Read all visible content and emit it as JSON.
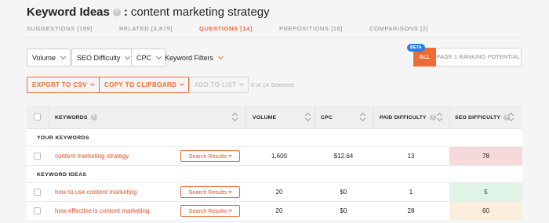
{
  "title": {
    "prefix": "Keyword Ideas",
    "separator": ":",
    "query": "content marketing strategy"
  },
  "tabs": [
    {
      "label": "SUGGESTIONS [199]",
      "active": false
    },
    {
      "label": "RELATED [3,879]",
      "active": false
    },
    {
      "label": "QUESTIONS [14]",
      "active": true
    },
    {
      "label": "PREPOSITIONS [16]",
      "active": false
    },
    {
      "label": "COMPARISONS [2]",
      "active": false
    }
  ],
  "filters": {
    "volume": "Volume",
    "seo_difficulty": "SEO Difficulty",
    "cpc": "CPC",
    "keyword_filters": "Keyword Filters"
  },
  "toggle": {
    "badge": "BETA",
    "all": "ALL",
    "page1": "PAGE 1 RANKING POTENTIAL"
  },
  "actions": {
    "export": "EXPORT TO CSV",
    "clipboard": "COPY TO CLIPBOARD",
    "add_to_list": "ADD TO LIST",
    "selected": "0 of 14 Selected"
  },
  "columns": {
    "keywords": "KEYWORDS",
    "volume": "VOLUME",
    "cpc": "CPC",
    "paid_difficulty": "PAID DIFFICULTY",
    "seo_difficulty": "SEO DIFFICULTY"
  },
  "sections": {
    "yours": "YOUR KEYWORDS",
    "ideas": "KEYWORD IDEAS"
  },
  "search_results_label": "Search Results",
  "your_keywords": [
    {
      "keyword": "content marketing strategy",
      "volume": "1,600",
      "cpc": "$12.64",
      "paid_difficulty": "13",
      "seo_difficulty": "78",
      "seo_color": "#f6d9da"
    }
  ],
  "keyword_ideas": [
    {
      "keyword": "how to use content marketing",
      "volume": "20",
      "cpc": "$0",
      "paid_difficulty": "1",
      "seo_difficulty": "5",
      "seo_color": "#dff3e6"
    },
    {
      "keyword": "how effective is content marketing",
      "volume": "20",
      "cpc": "$0",
      "paid_difficulty": "28",
      "seo_difficulty": "60",
      "seo_color": "#fbeedd"
    }
  ],
  "colors": {
    "accent": "#f06a35",
    "beta": "#2d7fe0"
  }
}
